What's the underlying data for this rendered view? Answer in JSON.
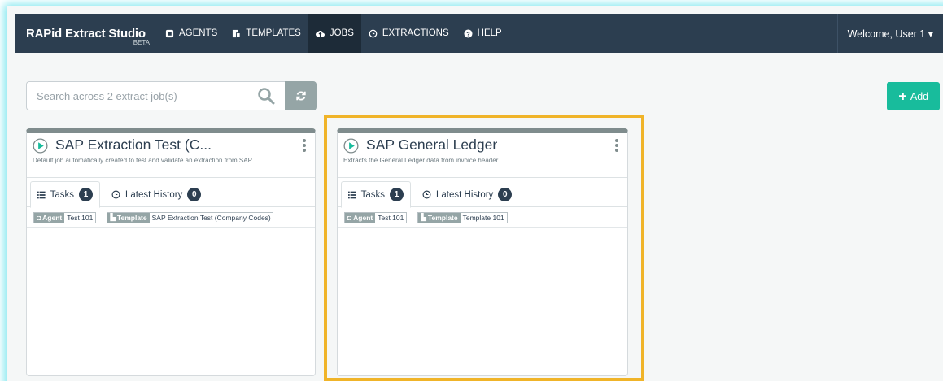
{
  "brand": {
    "name": "RAPid Extract Studio",
    "tag": "BETA"
  },
  "nav": {
    "items": [
      {
        "label": "AGENTS",
        "icon": "agent-icon"
      },
      {
        "label": "TEMPLATES",
        "icon": "template-icon"
      },
      {
        "label": "JOBS",
        "icon": "cloud-icon",
        "active": true
      },
      {
        "label": "EXTRACTIONS",
        "icon": "clock-icon"
      },
      {
        "label": "HELP",
        "icon": "help-icon"
      }
    ],
    "user": "Welcome, User 1 ▾"
  },
  "search": {
    "placeholder": "Search across 2 extract job(s)"
  },
  "add_button": {
    "label": "Add"
  },
  "colors": {
    "navbar": "#2c3e50",
    "accent": "#18bc9c",
    "highlight": "#f0b429",
    "play": "#18bc9c"
  },
  "cards": [
    {
      "title": "SAP Extraction Test (C...",
      "subtitle": "Default job automatically created to test and validate an extraction from SAP...",
      "tabs": {
        "tasks_label": "Tasks",
        "tasks_count": "1",
        "history_label": "Latest History",
        "history_count": "0"
      },
      "task": {
        "agent_key": "Agent",
        "agent_val": "Test 101",
        "template_key": "Template",
        "template_val": "SAP Extraction Test (Company Codes) S..."
      }
    },
    {
      "title": "SAP General Ledger",
      "subtitle": "Extracts the General Ledger data from invoice header",
      "tabs": {
        "tasks_label": "Tasks",
        "tasks_count": "1",
        "history_label": "Latest History",
        "history_count": "0"
      },
      "task": {
        "agent_key": "Agent",
        "agent_val": "Test 101",
        "template_key": "Template",
        "template_val": "Template 101"
      }
    }
  ]
}
